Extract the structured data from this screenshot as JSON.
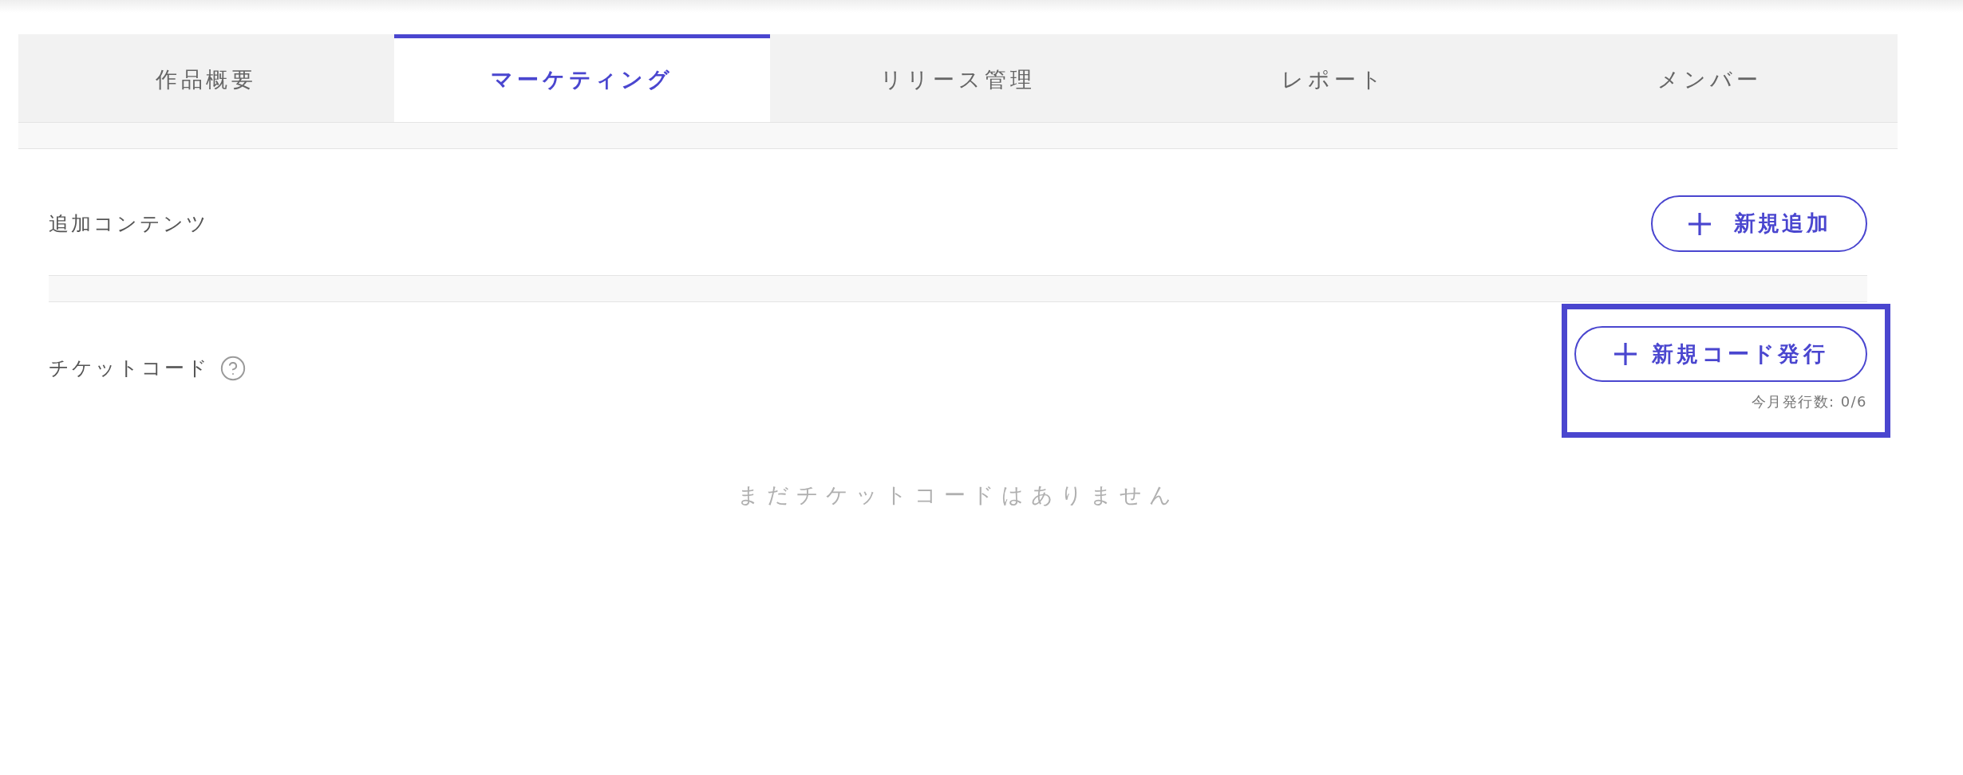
{
  "tabs": [
    {
      "label": "作品概要",
      "selected": false
    },
    {
      "label": "マーケティング",
      "selected": true
    },
    {
      "label": "リリース管理",
      "selected": false
    },
    {
      "label": "レポート",
      "selected": false
    },
    {
      "label": "メンバー",
      "selected": false
    }
  ],
  "additional_contents": {
    "title": "追加コンテンツ",
    "button": {
      "label": "新規追加"
    }
  },
  "ticket_codes": {
    "title": "チケットコード",
    "button": {
      "label": "新規コード発行"
    },
    "monthly_count": "今月発行数: 0/6",
    "highlighted": true,
    "empty_message": "まだチケットコードはありません"
  }
}
